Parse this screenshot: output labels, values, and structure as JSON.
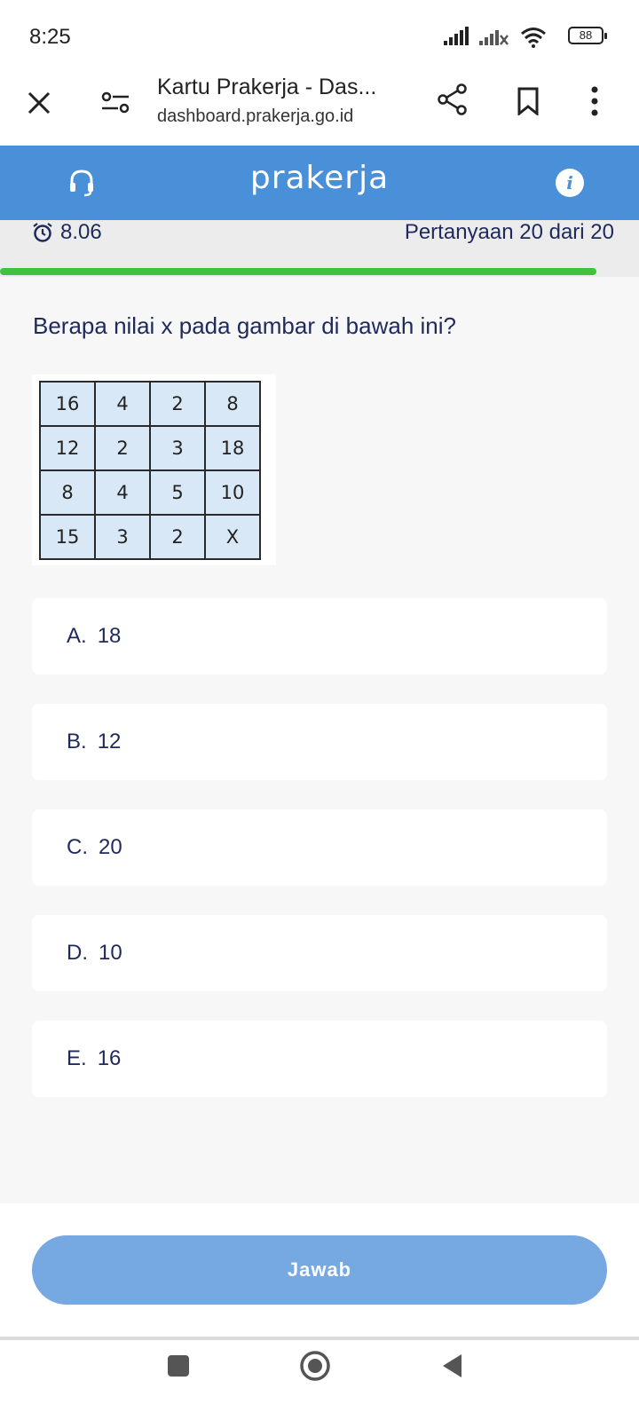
{
  "status_bar": {
    "time": "8:25",
    "battery": "88",
    "icons": [
      "signal-icon",
      "signal-no-data-icon",
      "wifi-icon",
      "battery-icon"
    ]
  },
  "browser": {
    "title": "Kartu Prakerja - Das...",
    "url": "dashboard.prakerja.go.id",
    "icons": [
      "close-icon",
      "site-settings-icon",
      "share-icon",
      "bookmark-icon",
      "more-menu-icon"
    ]
  },
  "app_header": {
    "logo": "prakerja",
    "icons": [
      "headset-icon",
      "info-icon"
    ],
    "info_glyph": "i",
    "color": "#4a90d9"
  },
  "quiz": {
    "timer": "8.06",
    "counter": "Pertanyaan 20 dari 20",
    "progress": 1.0,
    "question": "Berapa nilai x pada gambar di bawah ini?",
    "grid": [
      [
        "16",
        "4",
        "2",
        "8"
      ],
      [
        "12",
        "2",
        "3",
        "18"
      ],
      [
        "8",
        "4",
        "5",
        "10"
      ],
      [
        "15",
        "3",
        "2",
        "X"
      ]
    ],
    "options": [
      {
        "letter": "A.",
        "value": "18"
      },
      {
        "letter": "B.",
        "value": "12"
      },
      {
        "letter": "C.",
        "value": "20"
      },
      {
        "letter": "D.",
        "value": "10"
      },
      {
        "letter": "E.",
        "value": "16"
      }
    ],
    "answer_button": "Jawab",
    "colors": {
      "progress": "#3fc33f",
      "button": "#76a8e2",
      "text": "#1f2a5c"
    }
  },
  "nav_bar": {
    "icons": [
      "recent-apps-icon",
      "home-icon",
      "back-icon"
    ]
  }
}
